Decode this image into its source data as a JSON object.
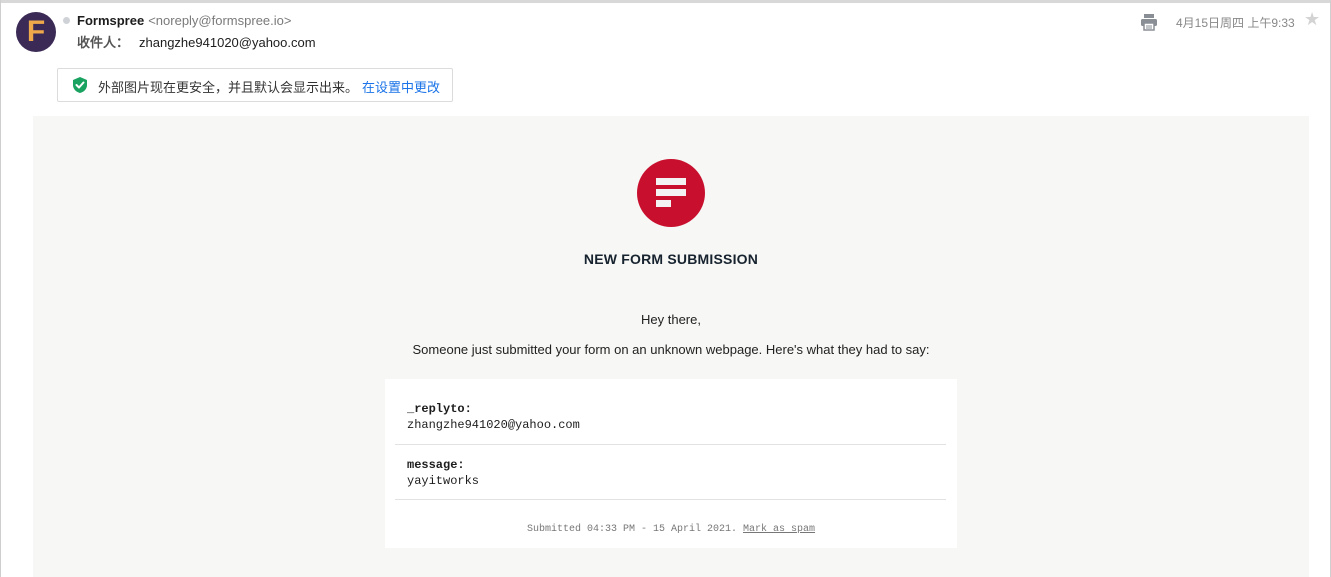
{
  "header": {
    "sender_name": "Formspree",
    "sender_email": "<noreply@formspree.io>",
    "recipient_label": "收件人：",
    "recipient_value": "zhangzhe941020@yahoo.com",
    "date": "4月15日周四 上午9:33",
    "avatar_letter": "F"
  },
  "notice": {
    "text": "外部图片现在更安全，并且默认会显示出来。",
    "link": "在设置中更改"
  },
  "email": {
    "headline": "NEW FORM SUBMISSION",
    "greeting": "Hey there,",
    "intro": "Someone just submitted your form on an unknown webpage. Here's what they had to say:",
    "fields": [
      {
        "key": "_replyto:",
        "value": "zhangzhe941020@yahoo.com"
      },
      {
        "key": "message:",
        "value": "yayitworks"
      }
    ],
    "footer_text": "Submitted 04:33 PM - 15 April 2021.",
    "spam_link": "Mark as spam"
  },
  "colors": {
    "brand_red": "#c8102e",
    "link_blue": "#1a73e8",
    "shield_green": "#1aa260"
  },
  "icons": [
    "print-icon",
    "star-icon",
    "shield-check-icon",
    "formspree-logo-icon"
  ]
}
